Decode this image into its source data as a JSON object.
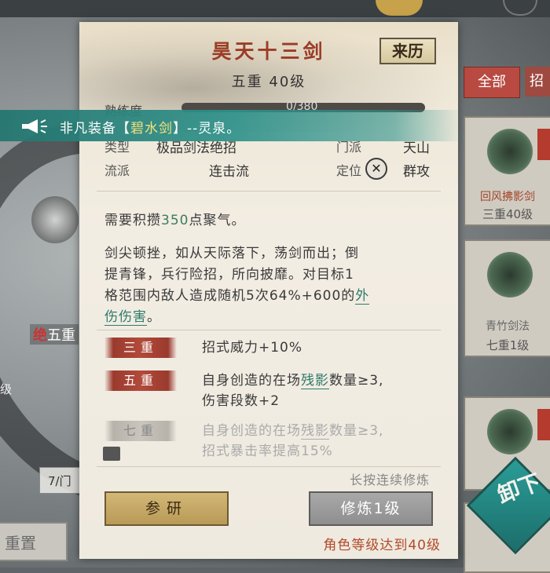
{
  "background": {
    "left_badge_red": "绝",
    "left_badge_text": "五重",
    "left_text": "级",
    "left_input": "7/门",
    "left_button": "重置",
    "filter_tab_all": "全部",
    "filter_tab_2": "招",
    "cards": [
      {
        "name": "回风拂影剑",
        "level": "三重40级"
      },
      {
        "name": "青竹剑法",
        "level": "七重1级"
      }
    ],
    "float_button": "卸下"
  },
  "banner": {
    "prefix": "非凡装备【",
    "highlight": "碧水剑",
    "suffix": "】--灵泉。"
  },
  "skill": {
    "title": "昊天十三剑",
    "source_button": "来历",
    "level_text": "五重 40级",
    "progress_label": "熟练度",
    "progress_text": "0/380",
    "progress_value": 0,
    "type_label": "类型",
    "type_value": "极品剑法绝招",
    "sect_label": "门派",
    "sect_value": "天山",
    "school_label": "流派",
    "school_value": "连击流",
    "position_label": "定位",
    "position_value": "群攻",
    "requirement_prefix": "需要积攒",
    "requirement_value": "350",
    "requirement_suffix": "点聚气。",
    "desc_line1": "剑尖顿挫，如从天际落下，荡剑而出；倒",
    "desc_line2": "提青锋，兵行险招，所向披靡。对目标1",
    "desc_line3": "格范围内敌人造成随机5次64%+600的",
    "desc_link1": "外",
    "desc_link2": "伤伤害",
    "desc_end": "。",
    "tiers": [
      {
        "name": "三重",
        "line1": "招式威力+10%",
        "line2": "",
        "locked": false
      },
      {
        "name": "五重",
        "line1_pre": "自身创造的在场",
        "line1_link": "残影",
        "line1_post": "数量≥3,",
        "line2": "伤害段数+2",
        "locked": false
      },
      {
        "name": "七重",
        "line1_pre": "自身创造的在场",
        "line1_link": "残影",
        "line1_post": "数量≥3,",
        "line2": "招式暴击率提高15%",
        "locked": true
      }
    ],
    "hint": "长按连续修炼",
    "study_button": "参研",
    "train_button": "修炼1级",
    "level_requirement": "角色等级达到40级"
  }
}
